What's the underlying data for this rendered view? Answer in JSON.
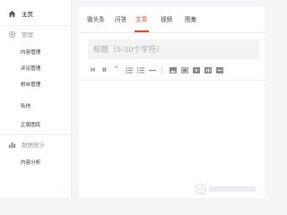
{
  "sidebar": {
    "home": {
      "label": "主页",
      "icon": "home-icon"
    },
    "manage": {
      "label": "管理",
      "icon": "gear-icon"
    },
    "manage_items": [
      "内容管理",
      "评论管理",
      "粉丝管理",
      "私信",
      "正版图库"
    ],
    "stats": {
      "label": "数据统计",
      "icon": "bar-chart-icon"
    },
    "stats_items": [
      "内容分析"
    ]
  },
  "tabs": [
    {
      "label": "微头条",
      "active": false
    },
    {
      "label": "问答",
      "active": false
    },
    {
      "label": "文章",
      "active": true
    },
    {
      "label": "视频",
      "active": false
    },
    {
      "label": "图集",
      "active": false
    }
  ],
  "editor": {
    "title_placeholder": "标题（5-30个字符）",
    "toolbar": [
      "H",
      "B",
      "“",
      "list-unordered",
      "list-ordered",
      "hr",
      "image",
      "image-gallery",
      "video",
      "audio",
      "link"
    ]
  },
  "colors": {
    "accent": "#e8452c",
    "sidebar_bg": "#ffffff",
    "page_bg": "#f4f5f6"
  }
}
